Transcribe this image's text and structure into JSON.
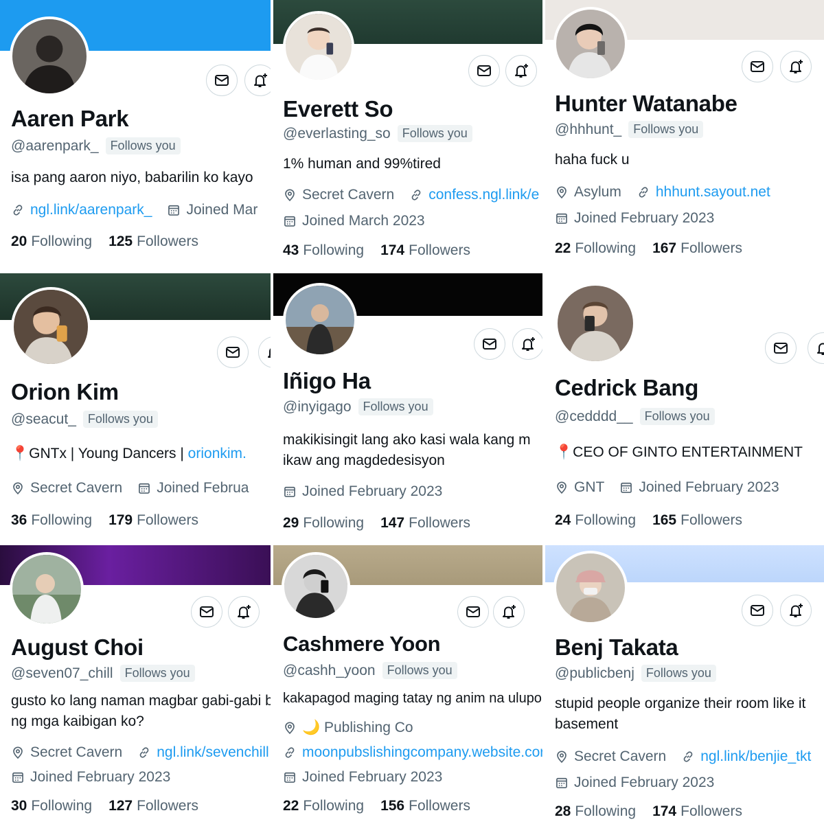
{
  "common": {
    "follows_you": "Follows you",
    "following_label": "Following",
    "followers_label": "Followers"
  },
  "profiles": [
    {
      "name": "Aaren Park",
      "handle": "@aarenpark_",
      "bio": "isa pang aaron niyo, babarilin ko kayo",
      "link": "ngl.link/aarenpark_",
      "joined": "Joined Mar",
      "following": "20",
      "followers": "125"
    },
    {
      "name": "Everett So",
      "handle": "@everlasting_so",
      "bio": "1% human and 99%tired",
      "location": "Secret Cavern",
      "link": "confess.ngl.link/e",
      "joined": "Joined March 2023",
      "following": "43",
      "followers": "174"
    },
    {
      "name": "Hunter Watanabe",
      "handle": "@hhhunt_",
      "bio": "haha fuck u",
      "location": "Asylum",
      "link": "hhhunt.sayout.net",
      "joined": "Joined February 2023",
      "following": "22",
      "followers": "167"
    },
    {
      "name": "Orion Kim",
      "handle": "@seacut_",
      "bio_prefix": "📍GNTx | Young Dancers | ",
      "bio_link": "orionkim.",
      "location": "Secret Cavern",
      "joined": "Joined Februa",
      "following": "36",
      "followers": "179"
    },
    {
      "name": "Iñigo Ha",
      "handle": "@inyigago",
      "bio_line1": "makikisingit lang ako kasi wala kang m",
      "bio_line2": "ikaw ang magdedesisyon",
      "joined": "Joined February 2023",
      "following": "29",
      "followers": "147"
    },
    {
      "name": "Cedrick Bang",
      "handle": "@cedddd__",
      "bio": "📍CEO OF GINTO ENTERTAINMENT",
      "location": "GNT",
      "joined": "Joined February 2023",
      "following": "24",
      "followers": "165"
    },
    {
      "name": "August Choi",
      "handle": "@seven07_chill",
      "bio_line1": "gusto ko lang naman magbar gabi-gabi b",
      "bio_line2": "ng mga kaibigan ko?",
      "location": "Secret Cavern",
      "link": "ngl.link/sevenchill",
      "joined": "Joined February 2023",
      "following": "30",
      "followers": "127"
    },
    {
      "name": "Cashmere Yoon",
      "handle": "@cashh_yoon",
      "bio": "kakapagod maging tatay ng anim na ulupo",
      "location": "🌙 Publishing Co",
      "link": "moonpubslishingcompany.website.cor",
      "joined": "Joined February 2023",
      "following": "22",
      "followers": "156"
    },
    {
      "name": "Benj Takata",
      "handle": "@publicbenj",
      "bio_line1": "stupid people organize their room like  it",
      "bio_line2": "basement",
      "location": "Secret Cavern",
      "link": "ngl.link/benjie_tkt",
      "joined": "Joined February 2023",
      "following": "28",
      "followers": "174"
    }
  ],
  "icons": {
    "message": "mail-icon",
    "notify": "bell-plus-icon",
    "location": "location-pin-icon",
    "link": "link-icon",
    "calendar": "calendar-icon"
  },
  "colors": {
    "link": "#1d9bf0",
    "secondary_text": "#536471",
    "primary_text": "#0f1419",
    "badge_bg": "#eff3f4",
    "button_border": "#cfd9de",
    "banner_blue": "#1d9bf0"
  }
}
